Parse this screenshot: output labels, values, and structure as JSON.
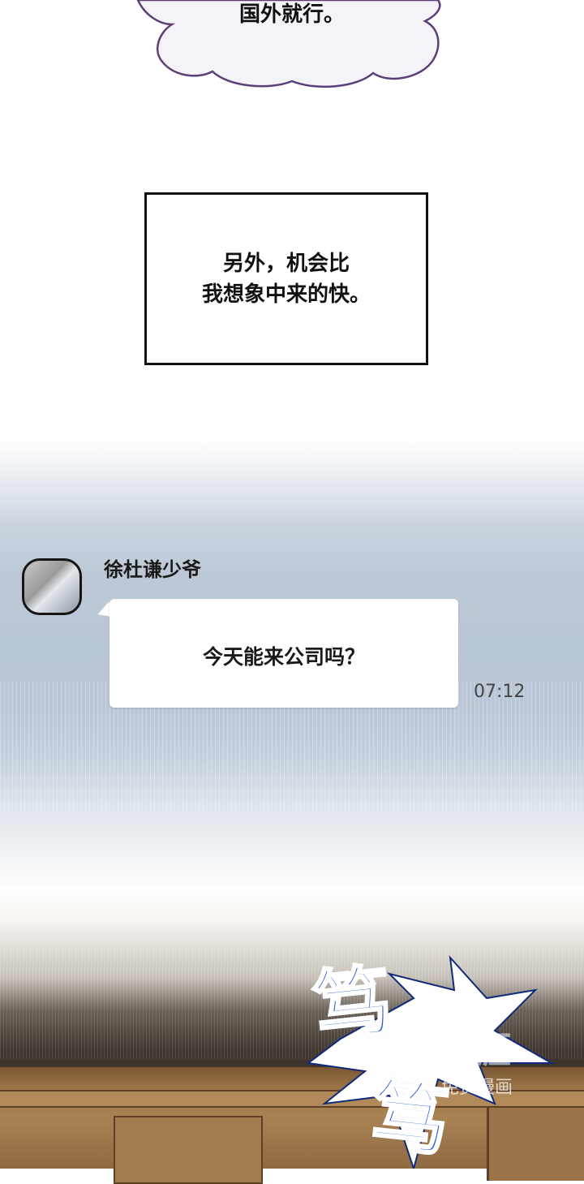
{
  "thought": {
    "text": "国外就行。"
  },
  "narration": {
    "lines": [
      "另外，机会比",
      "我想象中来的快。"
    ]
  },
  "chat": {
    "sender": "徐杜谦少爷",
    "message": "今天能来公司吗？",
    "time": "07:12"
  },
  "sfx": {
    "chars": [
      "笃",
      "笃"
    ]
  },
  "watermark": {
    "logo": "画涯",
    "sub": "免费漫画"
  },
  "colors": {
    "sfx": "#2b5bd8",
    "bubble_outline": "#5a3f78",
    "chat_bg": "#bcc8d6"
  }
}
